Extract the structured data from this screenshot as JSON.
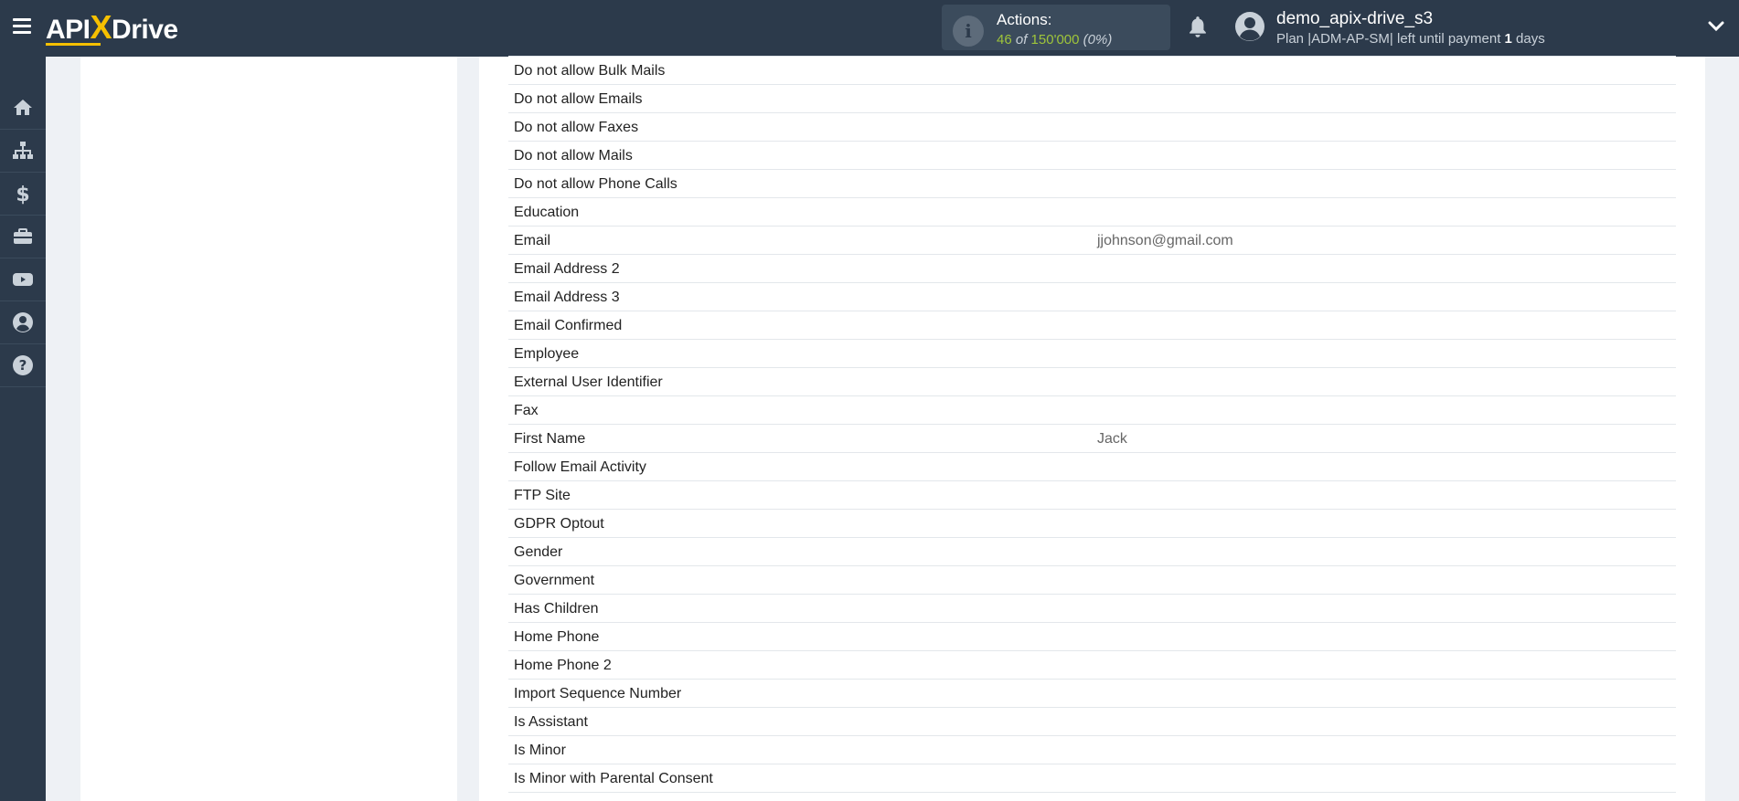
{
  "brand": {
    "logo_part1": "API",
    "logo_x": "X",
    "logo_part2": "Drive"
  },
  "header": {
    "actions_label": "Actions:",
    "actions_used": "46",
    "actions_of": "of",
    "actions_total": "150'000",
    "actions_pct": "(0%)",
    "user_name": "demo_apix-drive_s3",
    "plan_text_1": "Plan |ADM-AP-SM| left until payment ",
    "plan_days_num": "1",
    "plan_text_2": " days"
  },
  "sidebar": {
    "items": [
      {
        "icon": "home-icon"
      },
      {
        "icon": "sitemap-icon"
      },
      {
        "icon": "dollar-icon"
      },
      {
        "icon": "briefcase-icon"
      },
      {
        "icon": "youtube-icon"
      },
      {
        "icon": "user-circle-icon"
      },
      {
        "icon": "question-icon"
      }
    ]
  },
  "fields": [
    {
      "name": "Do not allow Bulk Mails",
      "value": ""
    },
    {
      "name": "Do not allow Emails",
      "value": ""
    },
    {
      "name": "Do not allow Faxes",
      "value": ""
    },
    {
      "name": "Do not allow Mails",
      "value": ""
    },
    {
      "name": "Do not allow Phone Calls",
      "value": ""
    },
    {
      "name": "Education",
      "value": ""
    },
    {
      "name": "Email",
      "value": "jjohnson@gmail.com"
    },
    {
      "name": "Email Address 2",
      "value": ""
    },
    {
      "name": "Email Address 3",
      "value": ""
    },
    {
      "name": "Email Confirmed",
      "value": ""
    },
    {
      "name": "Employee",
      "value": ""
    },
    {
      "name": "External User Identifier",
      "value": ""
    },
    {
      "name": "Fax",
      "value": ""
    },
    {
      "name": "First Name",
      "value": "Jack"
    },
    {
      "name": "Follow Email Activity",
      "value": ""
    },
    {
      "name": "FTP Site",
      "value": ""
    },
    {
      "name": "GDPR Optout",
      "value": ""
    },
    {
      "name": "Gender",
      "value": ""
    },
    {
      "name": "Government",
      "value": ""
    },
    {
      "name": "Has Children",
      "value": ""
    },
    {
      "name": "Home Phone",
      "value": ""
    },
    {
      "name": "Home Phone 2",
      "value": ""
    },
    {
      "name": "Import Sequence Number",
      "value": ""
    },
    {
      "name": "Is Assistant",
      "value": ""
    },
    {
      "name": "Is Minor",
      "value": ""
    },
    {
      "name": "Is Minor with Parental Consent",
      "value": ""
    }
  ],
  "colors": {
    "topbar": "#2c3a4b",
    "accent": "#f6c000",
    "actions_green": "#9fc53a"
  }
}
